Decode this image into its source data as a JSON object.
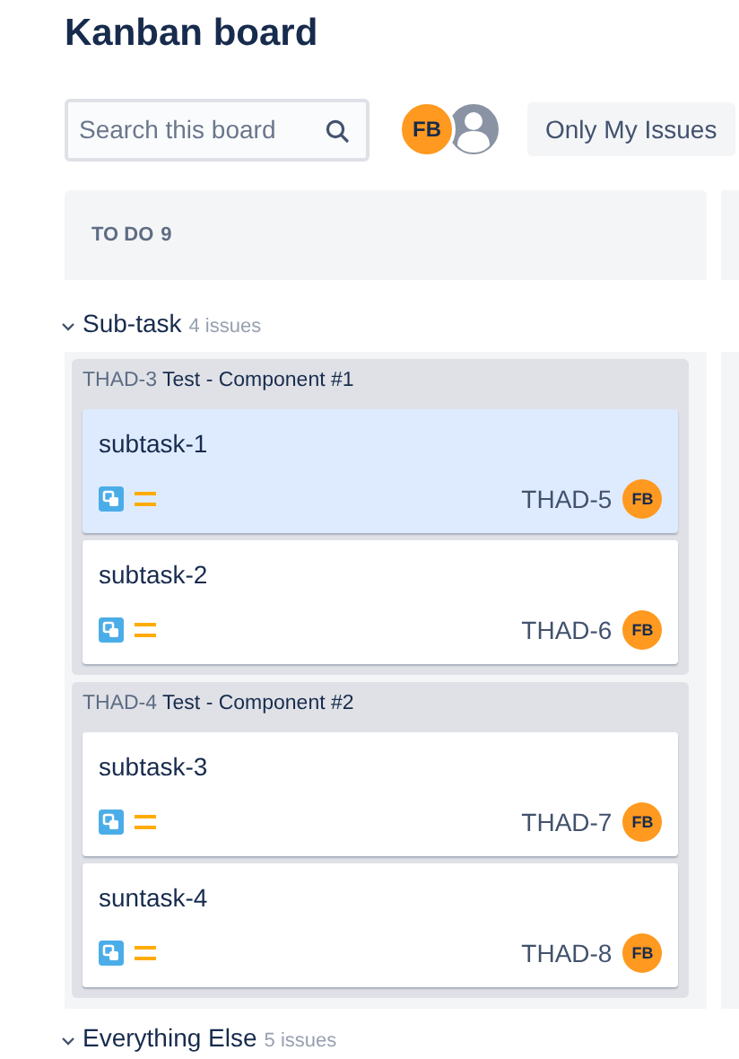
{
  "title": "Kanban board",
  "search": {
    "placeholder": "Search this board"
  },
  "avatars": [
    {
      "kind": "initials",
      "initials": "FB"
    },
    {
      "kind": "generic"
    }
  ],
  "filter_button": "Only My Issues",
  "column": {
    "name": "TO DO",
    "count": "9"
  },
  "swimlanes": [
    {
      "name": "Sub-task",
      "count": "4 issues",
      "parents": [
        {
          "key": "THAD-3",
          "summary": "Test - Component #1",
          "cards": [
            {
              "title": "subtask-1",
              "key": "THAD-5",
              "assignee": "FB",
              "selected": true
            },
            {
              "title": "subtask-2",
              "key": "THAD-6",
              "assignee": "FB",
              "selected": false
            }
          ]
        },
        {
          "key": "THAD-4",
          "summary": "Test - Component #2",
          "cards": [
            {
              "title": "subtask-3",
              "key": "THAD-7",
              "assignee": "FB",
              "selected": false
            },
            {
              "title": "suntask-4",
              "key": "THAD-8",
              "assignee": "FB",
              "selected": false
            }
          ]
        }
      ]
    },
    {
      "name": "Everything Else",
      "count": "5 issues"
    }
  ]
}
